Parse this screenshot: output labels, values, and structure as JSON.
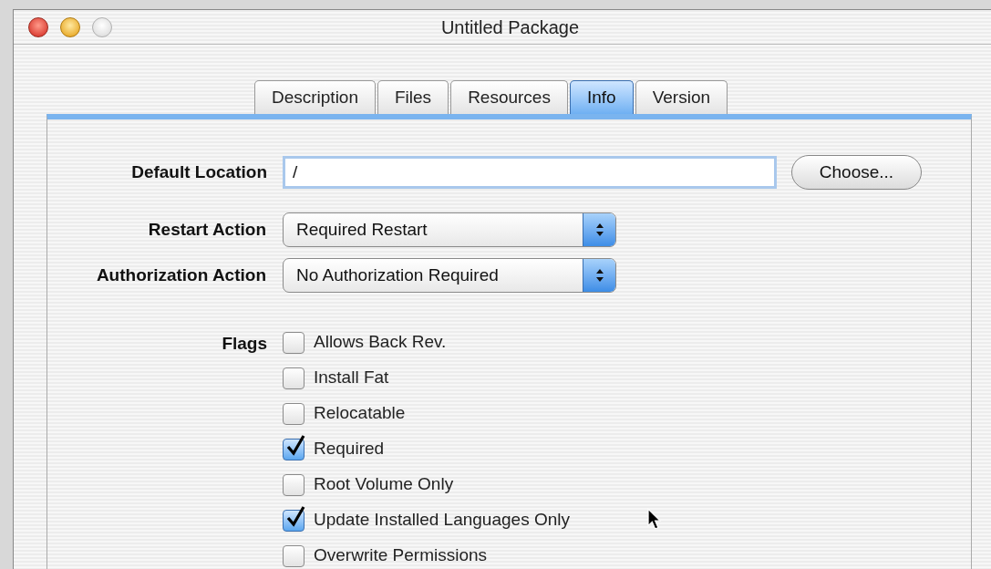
{
  "window": {
    "title": "Untitled Package"
  },
  "tabs": [
    {
      "label": "Description",
      "selected": false
    },
    {
      "label": "Files",
      "selected": false
    },
    {
      "label": "Resources",
      "selected": false
    },
    {
      "label": "Info",
      "selected": true
    },
    {
      "label": "Version",
      "selected": false
    }
  ],
  "default_location": {
    "label": "Default Location",
    "value": "/",
    "button": "Choose..."
  },
  "popups": [
    {
      "label": "Restart Action",
      "value": "Required Restart"
    },
    {
      "label": "Authorization Action",
      "value": "No Authorization Required"
    }
  ],
  "flags": {
    "label": "Flags",
    "items": [
      {
        "label": "Allows Back Rev.",
        "checked": false
      },
      {
        "label": "Install Fat",
        "checked": false
      },
      {
        "label": "Relocatable",
        "checked": false
      },
      {
        "label": "Required",
        "checked": true
      },
      {
        "label": "Root Volume Only",
        "checked": false
      },
      {
        "label": "Update Installed Languages Only",
        "checked": true
      },
      {
        "label": "Overwrite Permissions",
        "checked": false
      }
    ]
  }
}
